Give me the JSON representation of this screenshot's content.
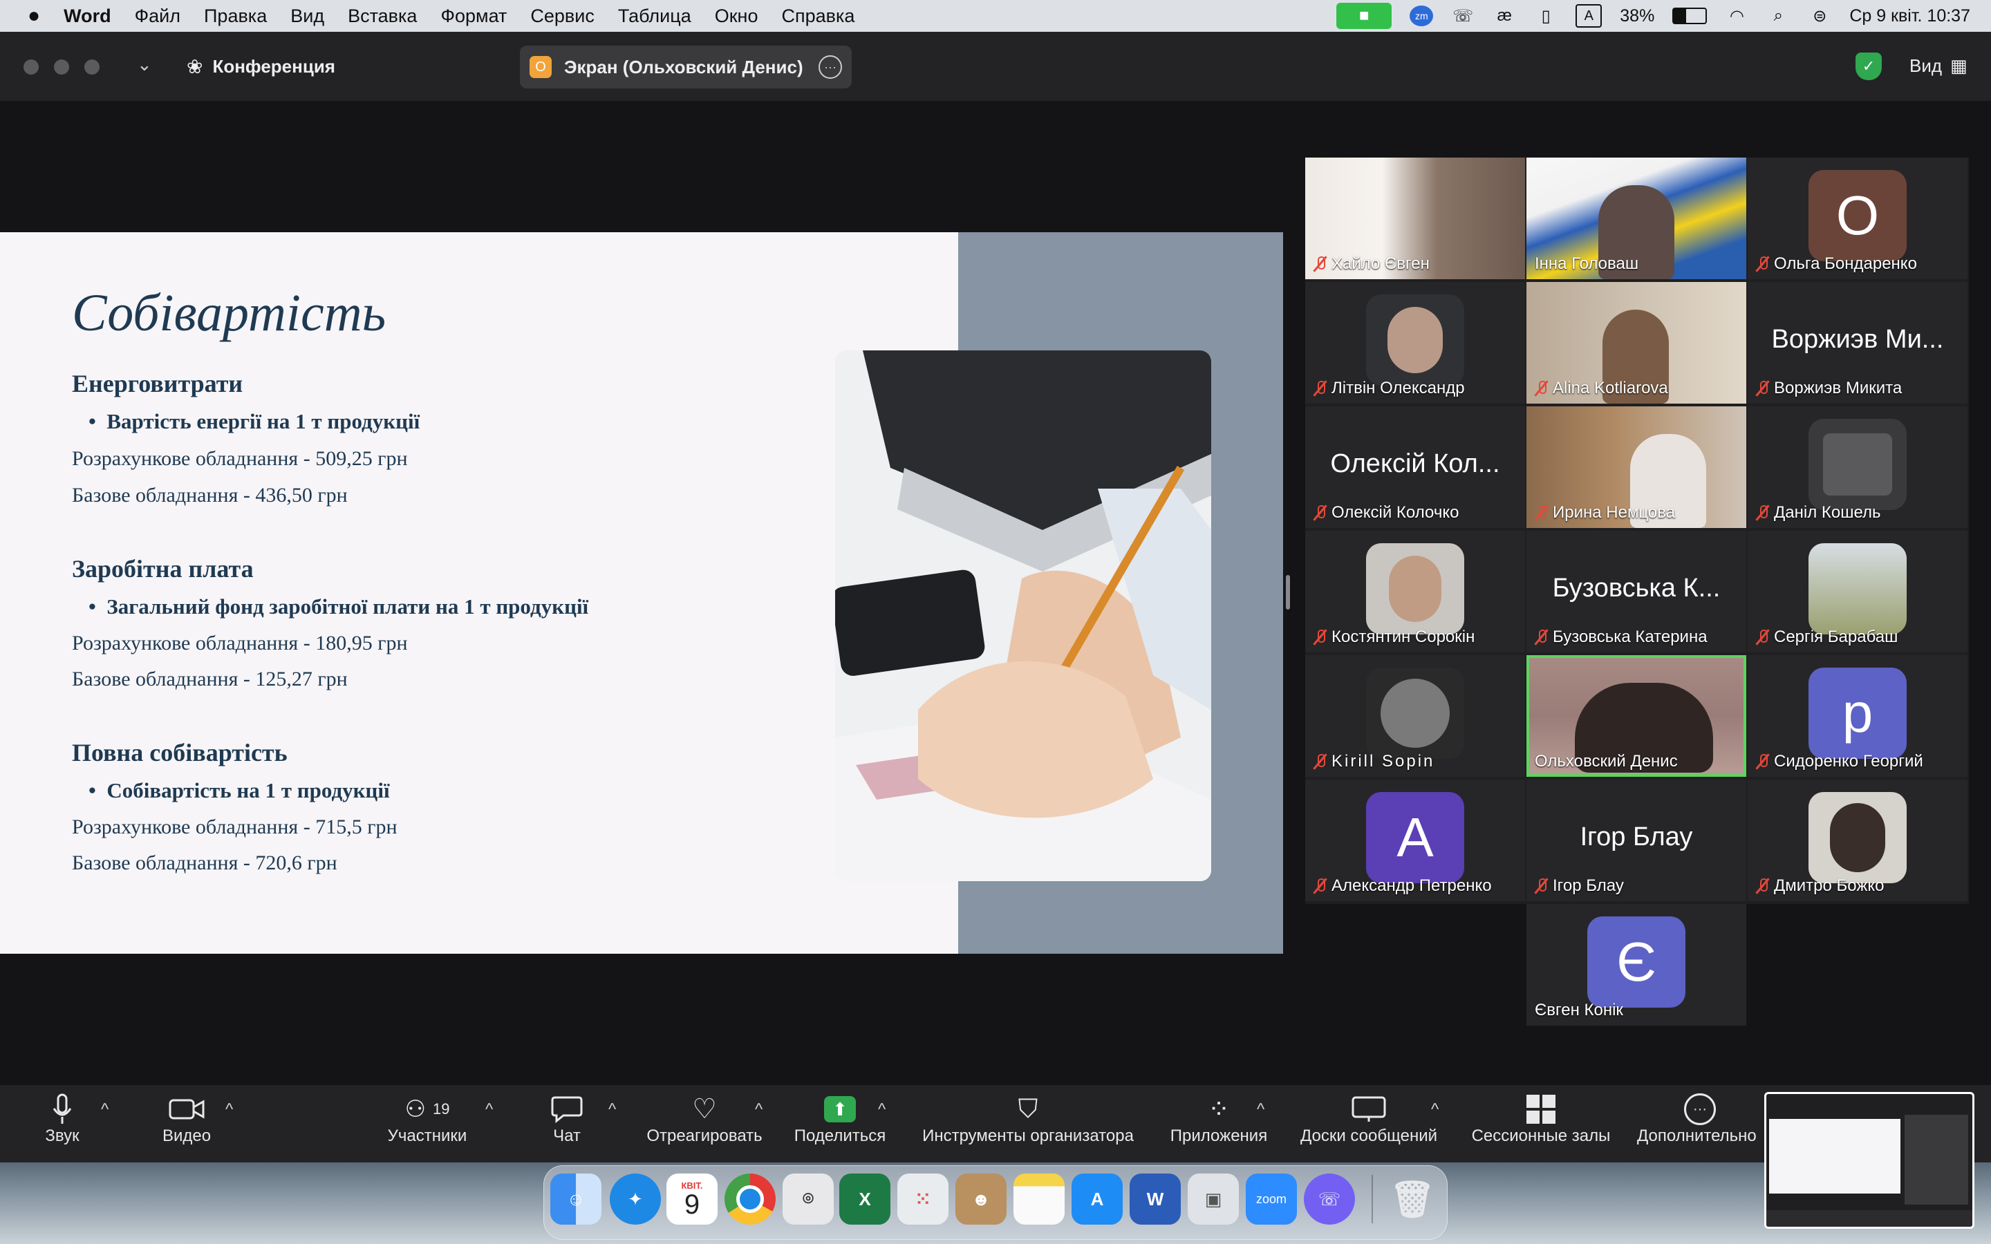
{
  "menubar": {
    "app": "Word",
    "items": [
      "Файл",
      "Правка",
      "Вид",
      "Вставка",
      "Формат",
      "Сервис",
      "Таблица",
      "Окно",
      "Справка"
    ],
    "battery": "38%",
    "input_source": "A",
    "datetime": "Ср 9 квіт.  10:37"
  },
  "zoom_titlebar": {
    "meeting_label": "Конференция",
    "share_badge": "О",
    "share_title": "Экран (Ольховский Денис)",
    "view_label": "Вид"
  },
  "slide": {
    "title": "Собівартість",
    "sections": [
      {
        "heading": "Енерговитрати",
        "bullet": "Вартість енергії на 1 т продукції",
        "line1": "Розрахункове обладнання - 509,25 грн",
        "line2": "Базове обладнання - 436,50 грн"
      },
      {
        "heading": "Заробітна плата",
        "bullet": "Загальний фонд заробітної плати на 1 т продукції",
        "line1": "Розрахункове обладнання - 180,95 грн",
        "line2": "Базове обладнання - 125,27 грн"
      },
      {
        "heading": "Повна собівартість",
        "bullet": "Собівартість на 1 т продукції",
        "line1": "Розрахункове обладнання - 715,5 грн",
        "line2": "Базове обладнання - 720,6 грн"
      }
    ]
  },
  "participants": [
    {
      "name": "Хайло Євген",
      "big": "",
      "avatar": "",
      "muted": true
    },
    {
      "name": "Інна Головаш",
      "big": "",
      "avatar": "",
      "muted": false
    },
    {
      "name": "Ольга Бондаренко",
      "big": "",
      "avatar": "O",
      "muted": true
    },
    {
      "name": "Літвін Олександр",
      "big": "",
      "avatar": "",
      "muted": true
    },
    {
      "name": "Alina Kotliarova",
      "big": "",
      "avatar": "",
      "muted": true
    },
    {
      "name": "Воржиэв Микита",
      "big": "Воржиэв Ми...",
      "avatar": "",
      "muted": true
    },
    {
      "name": "Олексій Колочко",
      "big": "Олексій Кол...",
      "avatar": "",
      "muted": true
    },
    {
      "name": "Ирина Немцова",
      "big": "",
      "avatar": "",
      "muted": true
    },
    {
      "name": "Даніл Кошель",
      "big": "",
      "avatar": "",
      "muted": true
    },
    {
      "name": "Костянтин Сорокін",
      "big": "",
      "avatar": "",
      "muted": true
    },
    {
      "name": "Бузовська Катерина",
      "big": "Бузовська К...",
      "avatar": "",
      "muted": true
    },
    {
      "name": "Сергія Барабаш",
      "big": "",
      "avatar": "",
      "muted": true
    },
    {
      "name": "Kirill Sopin",
      "big": "",
      "avatar": "",
      "muted": true
    },
    {
      "name": "Ольховский Денис",
      "big": "",
      "avatar": "",
      "muted": false
    },
    {
      "name": "Сидоренко Георгий",
      "big": "",
      "avatar": "p",
      "muted": true
    },
    {
      "name": "Александр Петренко",
      "big": "",
      "avatar": "A",
      "muted": true
    },
    {
      "name": "Ігор Блау",
      "big": "Ігор Блау",
      "avatar": "",
      "muted": true
    },
    {
      "name": "Дмитро Божко",
      "big": "",
      "avatar": "",
      "muted": true
    },
    {
      "name": "Євген Конік",
      "big": "",
      "avatar": "Є",
      "muted": false
    }
  ],
  "toolbar": {
    "audio": "Звук",
    "video": "Видео",
    "participants": "Участники",
    "participants_count": "19",
    "chat": "Чат",
    "react": "Отреагировать",
    "share": "Поделиться",
    "host_tools": "Инструменты организатора",
    "apps": "Приложения",
    "whiteboards": "Доски сообщений",
    "breakout": "Сессионные залы",
    "more": "Дополнительно"
  },
  "dock": {
    "calendar_month": "КВІТ.",
    "calendar_day": "9",
    "zoom_label": "zoom"
  },
  "colors": {
    "accent_green": "#2fa84f",
    "active_speaker": "#5fd35f",
    "slide_text": "#1f3a52",
    "slide_band": "#8694a3"
  }
}
